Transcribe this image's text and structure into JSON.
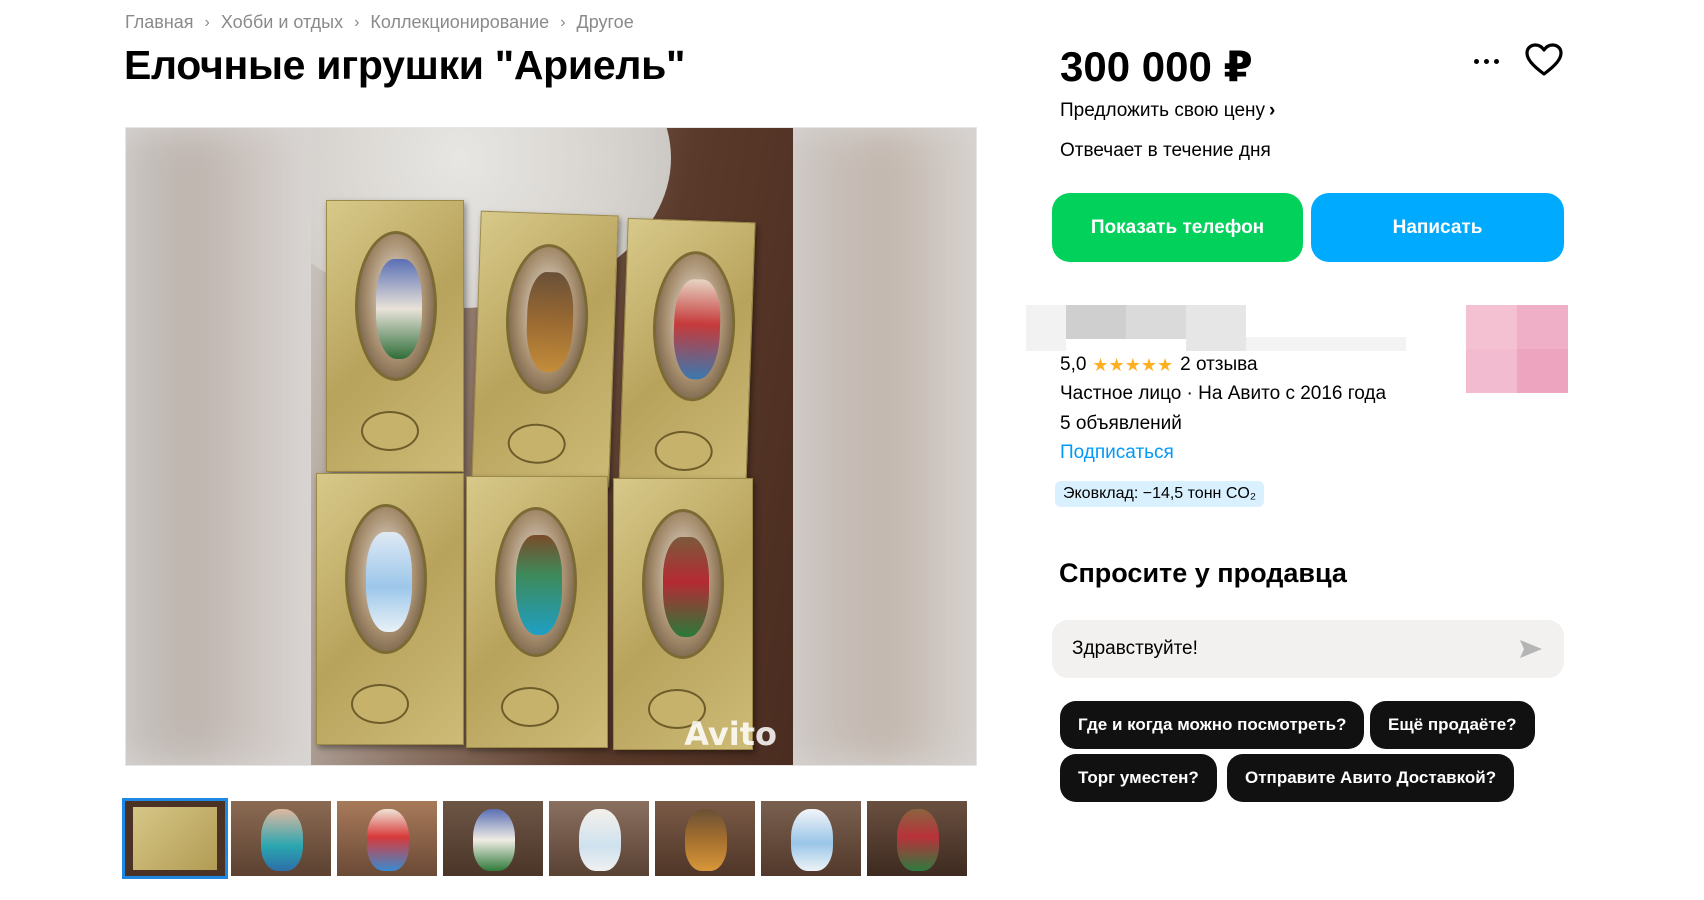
{
  "breadcrumbs": [
    "Главная",
    "Хобби и отдых",
    "Коллекционирование",
    "Другое"
  ],
  "title": "Елочные игрушки \"Ариель\"",
  "gallery": {
    "watermark": "Avito",
    "thumbnail_count": 8,
    "active_thumbnail": 1
  },
  "price": "300 000 ₽",
  "offer_price_label": "Предложить свою цену",
  "reply_time": "Отвечает в течение дня",
  "buttons": {
    "show_phone": "Показать телефон",
    "write": "Написать"
  },
  "seller": {
    "rating": "5,0",
    "stars": "★★★★★",
    "reviews": "2 отзыва",
    "type_since": "Частное лицо · На Авито с 2016 года",
    "ads_count": "5 объявлений",
    "subscribe": "Подписаться",
    "eco_badge": "Эковклад: −14,5 тонн CO₂"
  },
  "ask_seller": {
    "title": "Спросите у продавца",
    "message_value": "Здравствуйте!",
    "quick_questions": [
      "Где и когда можно посмотреть?",
      "Ещё продаёте?",
      "Торг уместен?",
      "Отправите Авито Доставкой?"
    ]
  },
  "colors": {
    "phone_button": "#02d15c",
    "write_button": "#00aaff",
    "link": "#0099f7",
    "stars": "#ffb021",
    "active_thumb_border": "#1e88e5"
  }
}
